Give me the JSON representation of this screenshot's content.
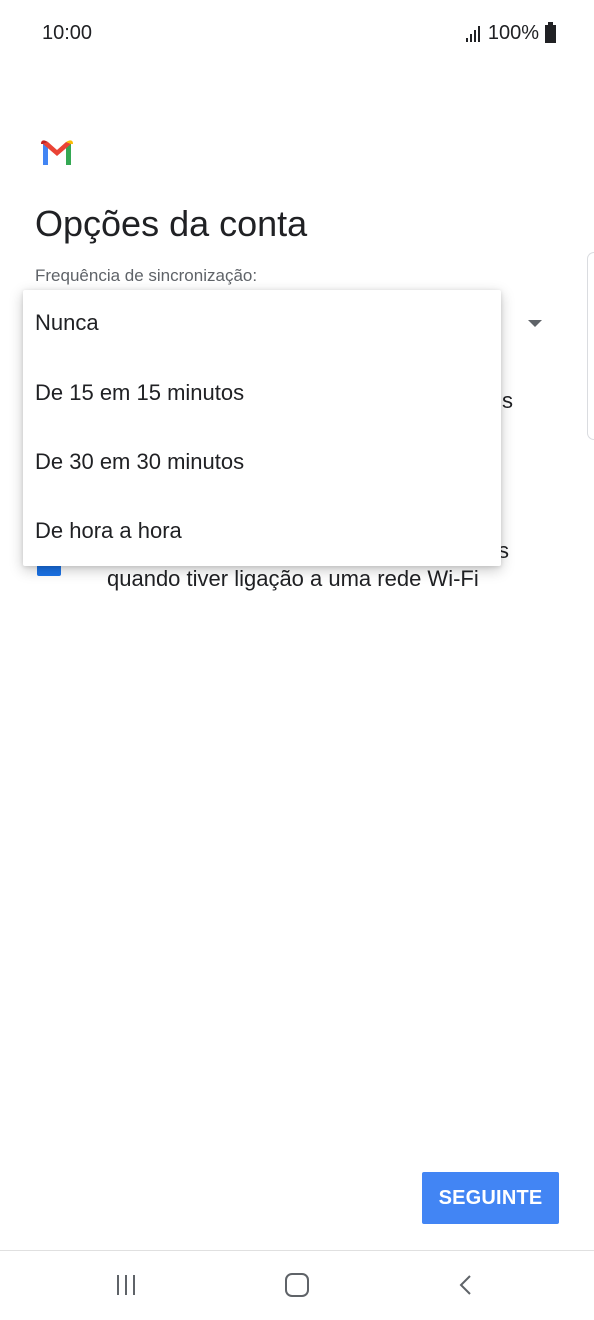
{
  "status_bar": {
    "time": "10:00",
    "battery": "100%",
    "icons": [
      "signal-icon",
      "battery-icon"
    ]
  },
  "header": {
    "logo": "gmail-logo",
    "title": "Opções da conta"
  },
  "sync": {
    "label": "Frequência de sincronização:",
    "options": [
      "Nunca",
      "De 15 em 15 minutos",
      "De 30 em 30 minutos",
      "De hora a hora"
    ]
  },
  "background": {
    "partial_text_1": "s",
    "partial_text_2": "s",
    "wifi_checkbox_label": "quando tiver ligação a uma rede Wi-Fi",
    "wifi_checkbox_checked": true
  },
  "footer": {
    "next_label": "SEGUINTE"
  },
  "nav": {
    "icons": [
      "recents-icon",
      "home-icon",
      "back-icon"
    ]
  },
  "colors": {
    "accent": "#4285f4",
    "checkbox": "#1a73e8"
  }
}
